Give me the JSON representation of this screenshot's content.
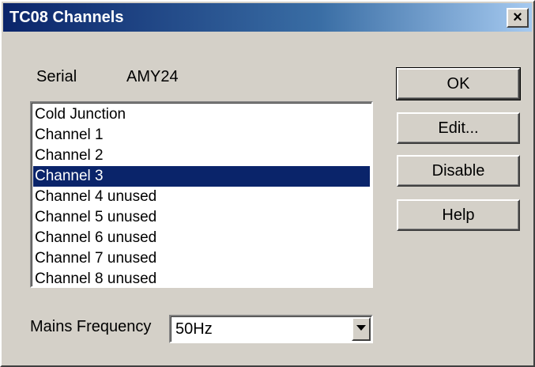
{
  "window": {
    "title": "TC08 Channels",
    "close_glyph": "✕"
  },
  "serial": {
    "label": "Serial",
    "value": "AMY24"
  },
  "channels": {
    "items": [
      "Cold Junction",
      "Channel 1",
      "Channel 2",
      "Channel 3",
      "Channel 4 unused",
      "Channel 5 unused",
      "Channel 6 unused",
      "Channel 7 unused",
      "Channel 8 unused"
    ],
    "selected_index": 3
  },
  "buttons": {
    "ok": "OK",
    "edit": "Edit...",
    "disable": "Disable",
    "help": "Help"
  },
  "mains": {
    "label": "Mains Frequency",
    "value": "50Hz"
  },
  "colors": {
    "selection": "#0a246a",
    "face": "#d4d0c8"
  }
}
